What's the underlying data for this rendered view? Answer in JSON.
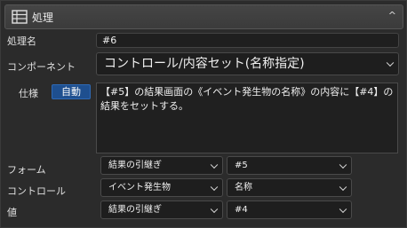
{
  "header": {
    "title": "処理",
    "icon": "table-icon",
    "collapse_icon": "chevron-up-icon"
  },
  "process_name": {
    "label": "処理名",
    "value": "#6"
  },
  "component": {
    "label": "コンポーネント",
    "value": "コントロール/内容セット(名称指定)"
  },
  "spec": {
    "label": "仕様",
    "badge": "自動",
    "text": "【#5】の結果画面の《イベント発生物の名称》の内容に【#4】の結果をセットする。"
  },
  "form": {
    "label": "フォーム",
    "select1": "結果の引継ぎ",
    "select2": "#5"
  },
  "control": {
    "label": "コントロール",
    "select1": "イベント発生物",
    "select2": "名称"
  },
  "value": {
    "label": "値",
    "select1": "結果の引継ぎ",
    "select2": "#4"
  },
  "colors": {
    "background": "#2b2b2b",
    "badge": "#1e4f8f"
  }
}
